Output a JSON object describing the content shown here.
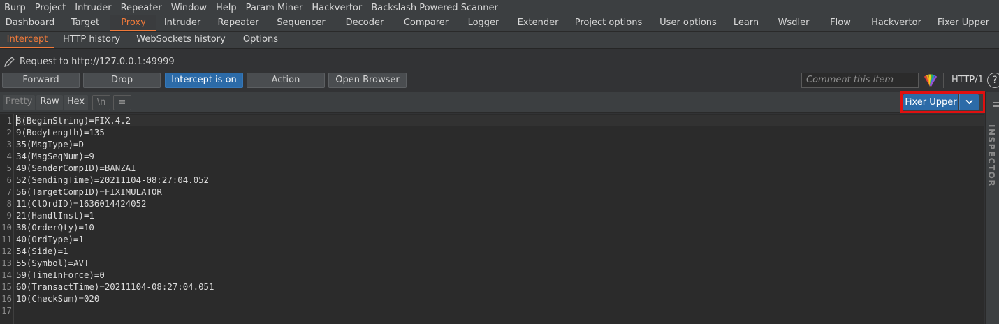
{
  "menubar": [
    "Burp",
    "Project",
    "Intruder",
    "Repeater",
    "Window",
    "Help",
    "Param Miner",
    "Hackvertor",
    "Backslash Powered Scanner"
  ],
  "main_tabs": [
    "Dashboard",
    "Target",
    "Proxy",
    "Intruder",
    "Repeater",
    "Sequencer",
    "Decoder",
    "Comparer",
    "Logger",
    "Extender",
    "Project options",
    "User options",
    "Learn",
    "Wsdler",
    "Flow",
    "Hackvertor",
    "Fixer Upper"
  ],
  "main_tabs_active": "Proxy",
  "sub_tabs": [
    "Intercept",
    "HTTP history",
    "WebSockets history",
    "Options"
  ],
  "sub_tabs_active": "Intercept",
  "request_info": "Request to http://127.0.0.1:49999",
  "toolbar": {
    "forward": "Forward",
    "drop": "Drop",
    "intercept": "Intercept is on",
    "action": "Action",
    "open_browser": "Open Browser",
    "comment_placeholder": "Comment this item",
    "protocol": "HTTP/1",
    "help": "?"
  },
  "editor_toolbar": {
    "pretty": "Pretty",
    "raw": "Raw",
    "hex": "Hex",
    "newline": "\\n",
    "menu": "≡",
    "fixer_upper": "Fixer Upper"
  },
  "editor_lines": [
    "8(BeginString)=FIX.4.2",
    "9(BodyLength)=135",
    "35(MsgType)=D",
    "34(MsgSeqNum)=9",
    "49(SenderCompID)=BANZAI",
    "52(SendingTime)=20211104-08:27:04.052",
    "56(TargetCompID)=FIXIMULATOR",
    "11(ClOrdID)=1636014424052",
    "21(HandlInst)=1",
    "38(OrderQty)=10",
    "40(OrdType)=1",
    "54(Side)=1",
    "55(Symbol)=AVT",
    "59(TimeInForce)=0",
    "60(TransactTime)=20211104-08:27:04.051",
    "10(CheckSum)=020",
    ""
  ],
  "inspector_label": "INSPECTOR",
  "colors": {
    "accent_orange": "#f07a3a",
    "primary_blue": "#2c6ba8",
    "highlight_red": "#e01010",
    "background": "#2b2b2b"
  }
}
